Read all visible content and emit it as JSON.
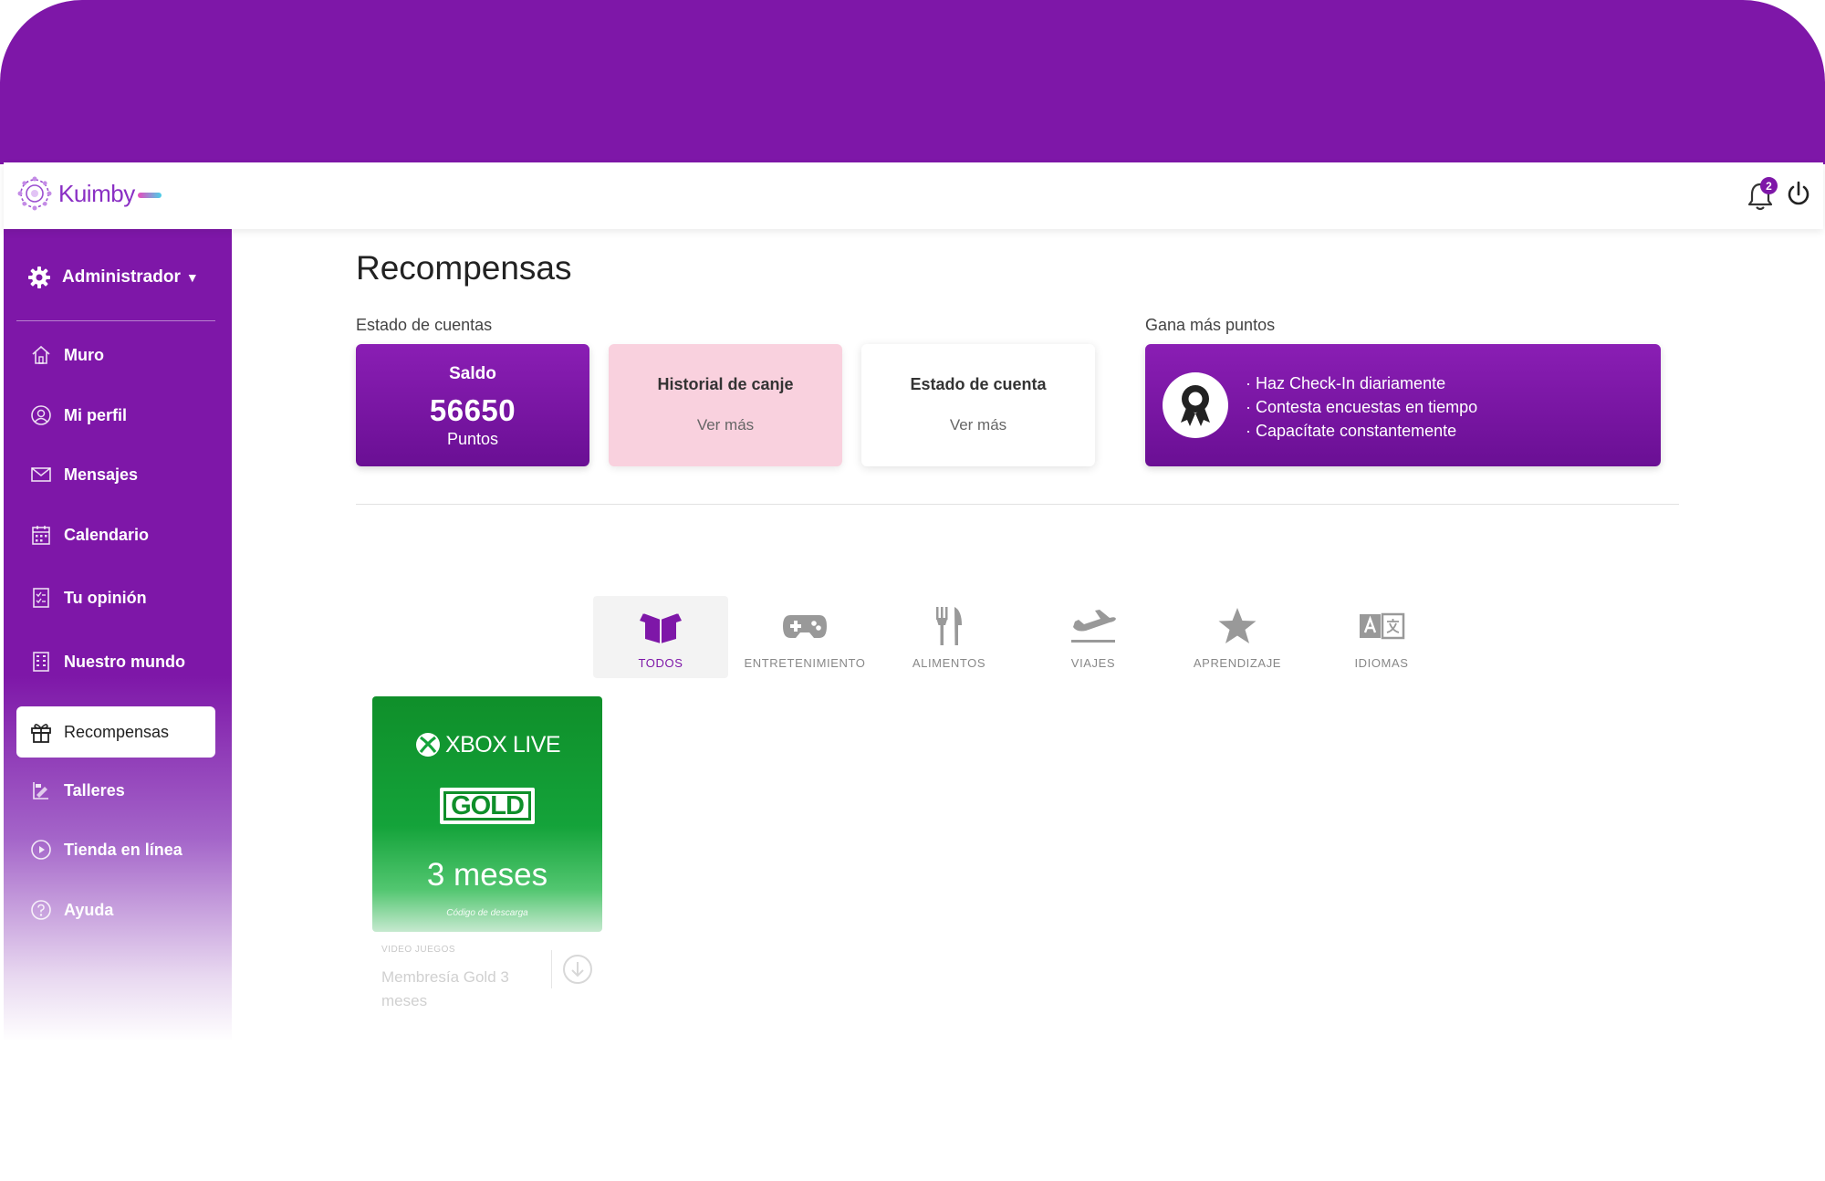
{
  "app": {
    "logo_text": "Kuimby",
    "notifications_count": "2"
  },
  "sidebar": {
    "admin_label": "Administrador",
    "items": [
      {
        "label": "Muro",
        "icon": "home-icon"
      },
      {
        "label": "Mi perfil",
        "icon": "user-icon"
      },
      {
        "label": "Mensajes",
        "icon": "mail-icon"
      },
      {
        "label": "Calendario",
        "icon": "calendar-icon"
      },
      {
        "label": "Tu opinión",
        "icon": "checklist-icon"
      },
      {
        "label": "Nuestro mundo",
        "icon": "building-icon"
      },
      {
        "label": "Recompensas",
        "icon": "gift-icon",
        "active": true
      },
      {
        "label": "Talleres",
        "icon": "workshop-icon"
      },
      {
        "label": "Tienda en línea",
        "icon": "play-icon"
      },
      {
        "label": "Ayuda",
        "icon": "help-icon"
      }
    ]
  },
  "main": {
    "title": "Recompensas",
    "estado_label": "Estado de cuentas",
    "saldo": {
      "title": "Saldo",
      "value": "56650",
      "unit": "Puntos"
    },
    "historial": {
      "title": "Historial de canje",
      "link": "Ver más"
    },
    "estado_cuenta": {
      "title": "Estado de cuenta",
      "link": "Ver más"
    },
    "gana_label": "Gana más puntos",
    "tips": [
      "· Haz Check-In diariamente",
      "· Contesta encuestas en tiempo",
      "· Capacítate constantemente"
    ],
    "categories": [
      {
        "label": "TODOS",
        "icon": "box-icon",
        "active": true
      },
      {
        "label": "ENTRETENIMIENTO",
        "icon": "gamepad-icon"
      },
      {
        "label": "ALIMENTOS",
        "icon": "utensils-icon"
      },
      {
        "label": "VIAJES",
        "icon": "plane-icon"
      },
      {
        "label": "APRENDIZAJE",
        "icon": "star-icon"
      },
      {
        "label": "IDIOMAS",
        "icon": "translate-icon"
      }
    ],
    "product": {
      "brand": "XBOX LIVE",
      "badge": "GOLD",
      "duration": "3 meses",
      "note": "Código de descarga",
      "category": "VIDEO JUEGOS",
      "name": "Membresía Gold 3 meses"
    }
  },
  "colors": {
    "brand": "#7e17a8",
    "pink_card": "#f9d1de",
    "xbox_green": "#14a33a"
  }
}
